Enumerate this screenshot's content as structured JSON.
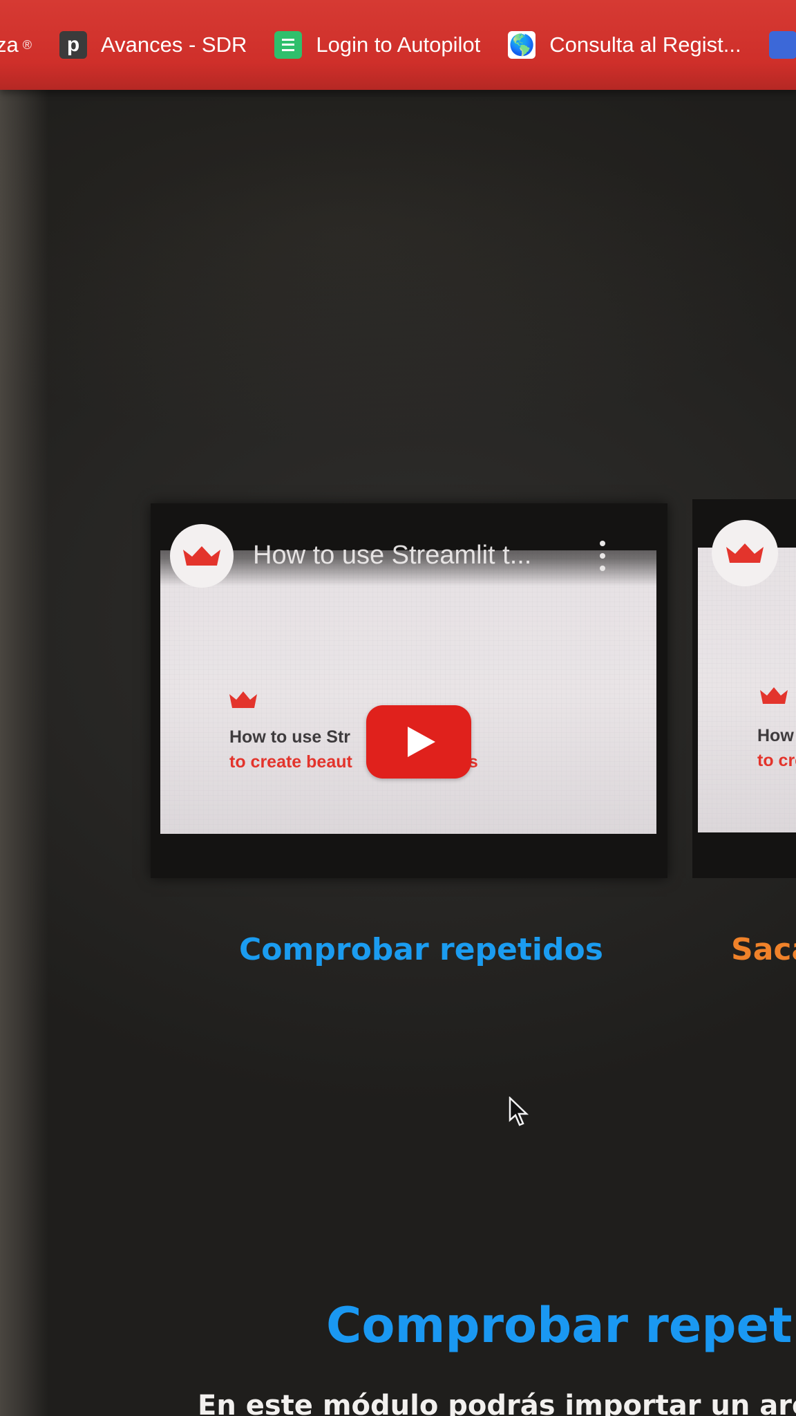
{
  "bookmarks_bar": {
    "items": [
      {
        "label": "za",
        "trail": "®",
        "icon": "bookmark-partial-icon"
      },
      {
        "label": "Avances - SDR",
        "icon": "p-letter-icon",
        "icon_text": "p"
      },
      {
        "label": "Login to Autopilot",
        "icon": "autopilot-icon"
      },
      {
        "label": "Consulta al Regist...",
        "icon": "globe-icon",
        "icon_text": "🌎"
      }
    ]
  },
  "videos": [
    {
      "title": "How to use Streamlit t...",
      "thumb_line1": "How to use Str",
      "thumb_line2": "to create beaut",
      "thumb_line2_tail": "s",
      "label": "Comprobar repetidos",
      "label_color": "#1b9cf0"
    },
    {
      "thumb_line1": "How",
      "thumb_line2": "to cre",
      "label": "Saca",
      "label_color": "#f0822a"
    }
  ],
  "section": {
    "heading": "Comprobar repetidos",
    "body": "En este módulo podrás importar un arch"
  },
  "colors": {
    "bookmarks_bar": "#cf2f2a",
    "youtube_red": "#e0211c",
    "streamlit_red": "#e3342c",
    "heading_blue": "#1a98f2"
  }
}
